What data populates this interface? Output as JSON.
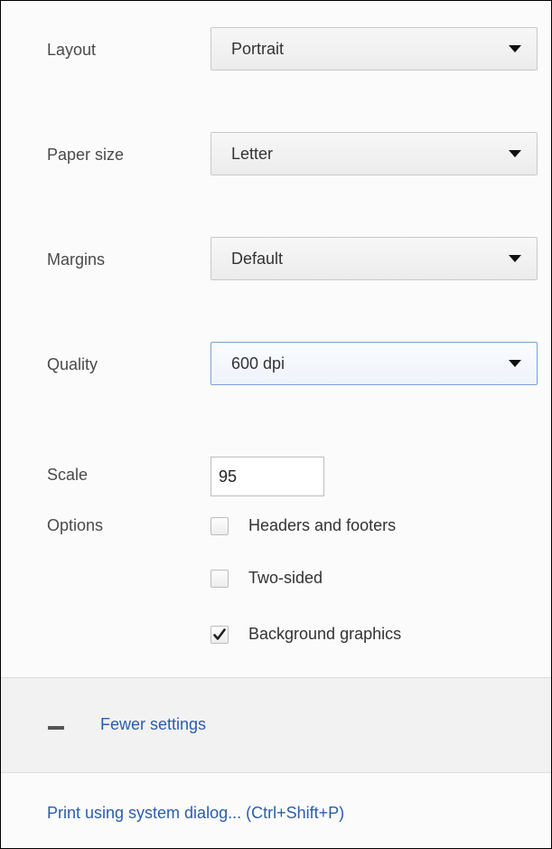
{
  "layout": {
    "label": "Layout",
    "value": "Portrait"
  },
  "paper_size": {
    "label": "Paper size",
    "value": "Letter"
  },
  "margins": {
    "label": "Margins",
    "value": "Default"
  },
  "quality": {
    "label": "Quality",
    "value": "600 dpi"
  },
  "scale": {
    "label": "Scale",
    "value": "95"
  },
  "options": {
    "label": "Options",
    "items": [
      {
        "label": "Headers and footers",
        "checked": false
      },
      {
        "label": "Two-sided",
        "checked": false
      },
      {
        "label": "Background graphics",
        "checked": true
      }
    ]
  },
  "fewer_settings": {
    "label": "Fewer settings",
    "icon": "minus-icon"
  },
  "system_dialog": {
    "label": "Print using system dialog... (Ctrl+Shift+P)"
  },
  "colors": {
    "link": "#2a5db0",
    "focus_border": "#7ca3d6"
  }
}
